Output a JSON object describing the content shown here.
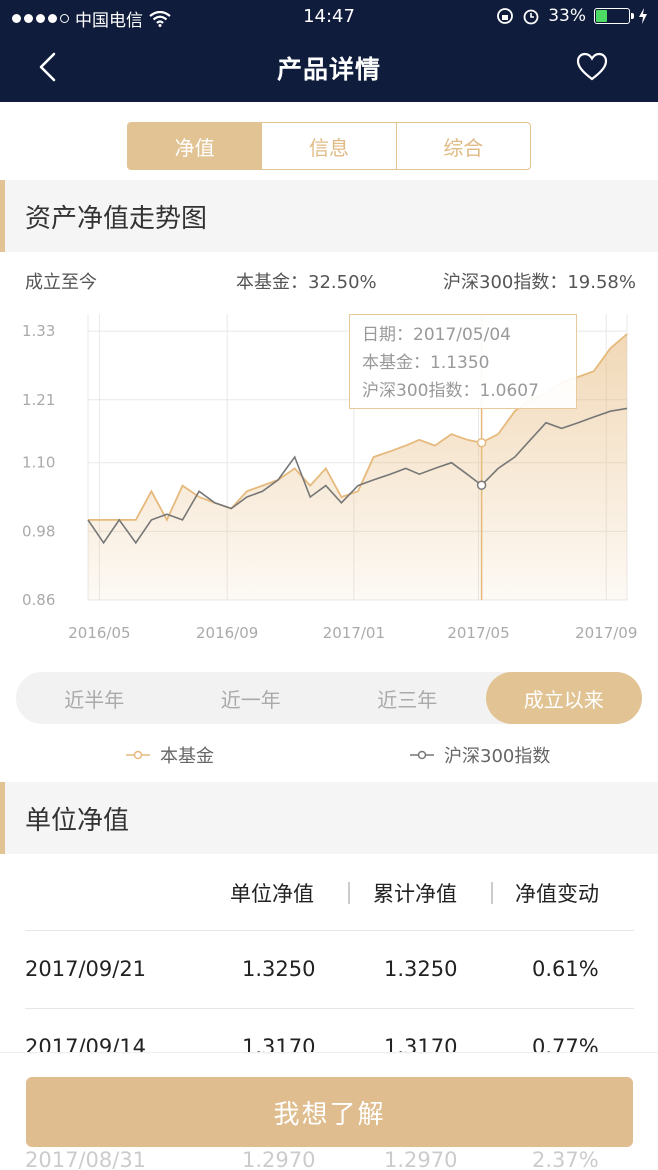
{
  "status": {
    "carrier": "中国电信",
    "time": "14:47",
    "battery": "33%",
    "battery_level": 0.33
  },
  "nav": {
    "title": "产品详情",
    "back_icon": "chevron-left-icon",
    "favorite_icon": "heart-icon"
  },
  "tabs": [
    {
      "label": "净值",
      "active": true
    },
    {
      "label": "信息",
      "active": false
    },
    {
      "label": "综合",
      "active": false
    }
  ],
  "trend": {
    "heading": "资产净值走势图",
    "period_label": "成立至今",
    "fund_return": "本基金：32.50%",
    "index_return": "沪深300指数：19.58%"
  },
  "tooltip": {
    "date": "日期：2017/05/04",
    "fund": "本基金：1.1350",
    "index": "沪深300指数：1.0607"
  },
  "colors": {
    "accent": "#e2c394",
    "fund_line": "#e6b97c",
    "index_line": "#777777",
    "navbar": "#0f1c3c"
  },
  "chart_data": {
    "type": "area",
    "ylim": [
      0.86,
      1.36
    ],
    "yticks": [
      "1.33",
      "1.21",
      "1.10",
      "0.98",
      "0.86"
    ],
    "ytick_values": [
      1.33,
      1.21,
      1.1,
      0.98,
      0.86
    ],
    "xticks": [
      "2016/05",
      "2016/09",
      "2017/01",
      "2017/05",
      "2017/09"
    ],
    "x": [
      "2016/04/20",
      "2016/05/05",
      "2016/05/20",
      "2016/06/05",
      "2016/06/20",
      "2016/07/05",
      "2016/07/20",
      "2016/08/05",
      "2016/08/20",
      "2016/09/05",
      "2016/09/20",
      "2016/10/05",
      "2016/10/20",
      "2016/11/05",
      "2016/11/20",
      "2016/12/05",
      "2016/12/20",
      "2017/01/05",
      "2017/01/20",
      "2017/02/05",
      "2017/02/20",
      "2017/03/05",
      "2017/03/20",
      "2017/04/05",
      "2017/04/20",
      "2017/05/04",
      "2017/05/20",
      "2017/06/05",
      "2017/06/20",
      "2017/07/05",
      "2017/07/20",
      "2017/08/05",
      "2017/08/20",
      "2017/09/05",
      "2017/09/21"
    ],
    "series": [
      {
        "name": "本基金",
        "values": [
          1.0,
          1.0,
          1.0,
          1.0,
          1.05,
          1.0,
          1.06,
          1.04,
          1.03,
          1.02,
          1.05,
          1.06,
          1.07,
          1.09,
          1.06,
          1.09,
          1.04,
          1.05,
          1.11,
          1.12,
          1.13,
          1.14,
          1.13,
          1.15,
          1.14,
          1.135,
          1.15,
          1.19,
          1.21,
          1.22,
          1.24,
          1.25,
          1.26,
          1.3,
          1.325
        ]
      },
      {
        "name": "沪深300指数",
        "values": [
          1.0,
          0.96,
          1.0,
          0.96,
          1.0,
          1.01,
          1.0,
          1.05,
          1.03,
          1.02,
          1.04,
          1.05,
          1.07,
          1.11,
          1.04,
          1.06,
          1.03,
          1.06,
          1.07,
          1.08,
          1.09,
          1.08,
          1.09,
          1.1,
          1.08,
          1.0607,
          1.09,
          1.11,
          1.14,
          1.17,
          1.16,
          1.17,
          1.18,
          1.19,
          1.195
        ]
      }
    ]
  },
  "periods": [
    {
      "label": "近半年",
      "active": false
    },
    {
      "label": "近一年",
      "active": false
    },
    {
      "label": "近三年",
      "active": false
    },
    {
      "label": "成立以来",
      "active": true
    }
  ],
  "legend": {
    "fund": "本基金",
    "index": "沪深300指数"
  },
  "nav_table": {
    "heading": "单位净值",
    "columns": [
      "单位净值",
      "累计净值",
      "净值变动"
    ],
    "rows": [
      {
        "date": "2017/09/21",
        "unit": "1.3250",
        "cumulative": "1.3250",
        "change": "0.61%"
      },
      {
        "date": "2017/09/14",
        "unit": "1.3170",
        "cumulative": "1.3170",
        "change": "0.77%"
      },
      {
        "date": "2017/08/31",
        "unit": "1.2970",
        "cumulative": "1.2970",
        "change": "2.37%"
      }
    ]
  },
  "cta": {
    "label": "我想了解"
  }
}
